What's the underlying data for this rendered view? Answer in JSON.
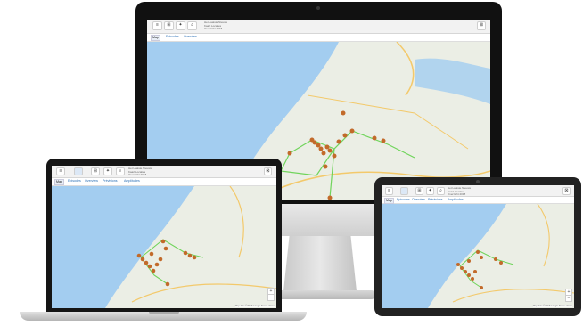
{
  "app": {
    "toolbar": {
      "buttons": [
        "≡",
        "⊞",
        "✦",
        "⌕"
      ],
      "info_lines": "Het Laatste Nieuws\nKaart Locaties\nOverzicht 2018",
      "right_button": "⊠"
    },
    "tabs_desktop": [
      "Map",
      "Episodes",
      "Overview"
    ],
    "tabs_full": [
      "Map",
      "Episodes",
      "Overview",
      "Prévisions",
      "Amplitudes"
    ],
    "zoom_in": "+",
    "zoom_out": "−",
    "footer": "Map data ©2018 Google  Terms of Use"
  },
  "colors": {
    "water": "#a3cdf0",
    "land": "#ebeee5",
    "route": "#6fd45a",
    "marker": "#c26a2a"
  }
}
